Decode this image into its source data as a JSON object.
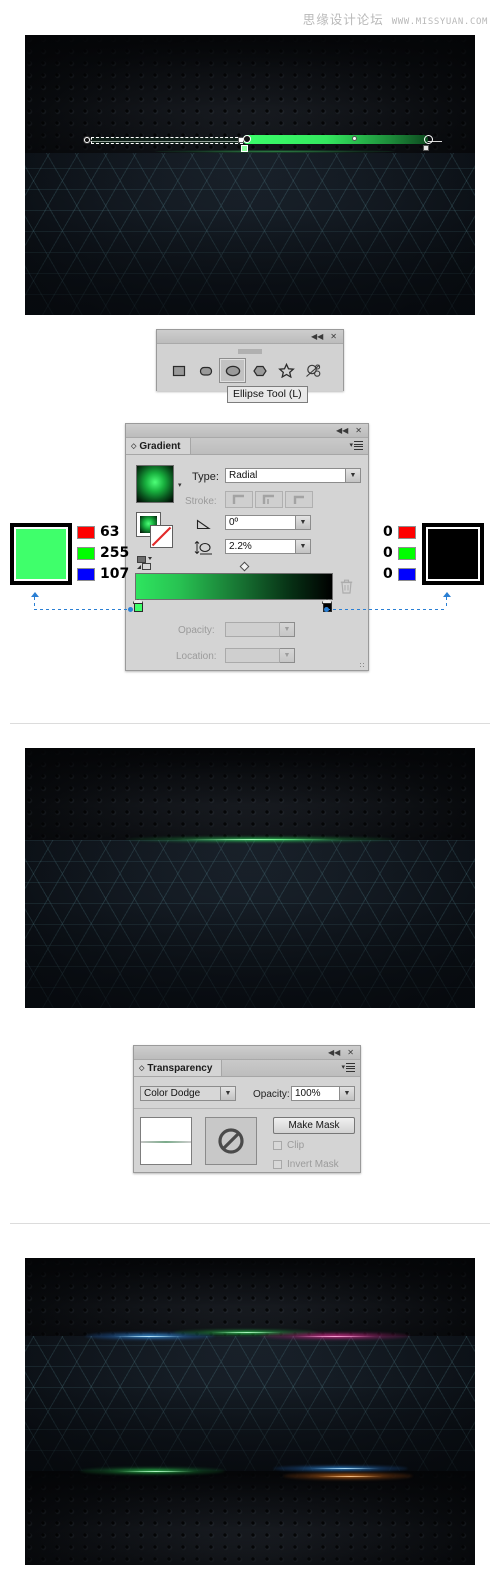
{
  "watermark": {
    "cn": "思缘设计论坛",
    "url": "WWW.MISSYUAN.COM"
  },
  "artworks": [
    {
      "name": "step1-gradient-ellipse-canvas",
      "caption_none": "",
      "annotation": "radial gradient annotator on green ellipse"
    },
    {
      "name": "step2-green-glow-result",
      "annotation": "single green glow streak"
    },
    {
      "name": "step3-final-multicolor-result",
      "annotation": "blue green pink orange glow streaks"
    }
  ],
  "tool_flyout": {
    "title": "shape-tools-flyout",
    "collapse_label": "◀◀",
    "close_label": "✕",
    "tools": [
      {
        "name": "rectangle-tool",
        "label": "Rectangle Tool",
        "selected": false
      },
      {
        "name": "rounded-rectangle-tool",
        "label": "Rounded Rectangle Tool",
        "selected": false
      },
      {
        "name": "ellipse-tool",
        "label": "Ellipse Tool",
        "selected": true
      },
      {
        "name": "polygon-tool",
        "label": "Polygon Tool",
        "selected": false
      },
      {
        "name": "star-tool",
        "label": "Star Tool",
        "selected": false
      },
      {
        "name": "flare-tool",
        "label": "Flare Tool",
        "selected": false
      }
    ],
    "tooltip": "Ellipse Tool (L)"
  },
  "gradient_panel": {
    "tab_label": "Gradient",
    "collapse_label": "◀◀",
    "close_label": "✕",
    "type_label": "Type:",
    "type_value": "Radial",
    "stroke_label": "Stroke:",
    "stroke_options": [
      "stroke-within",
      "stroke-across",
      "stroke-along"
    ],
    "angle_label": "angle",
    "angle_value": "0º",
    "aspect_label": "aspect-ratio",
    "aspect_value": "2.2%",
    "opacity_label": "Opacity:",
    "opacity_value": "",
    "location_label": "Location:",
    "location_value": "",
    "delete_stop_label": "delete-stop",
    "gradient_preview": "radial green to black",
    "stops": [
      {
        "name": "gradient-stop-start",
        "color": "#3FFF6B",
        "position": 0
      },
      {
        "name": "gradient-stop-end",
        "color": "#000000",
        "position": 100
      }
    ],
    "midpoint": 50
  },
  "color_left": {
    "name": "start-color-swatch",
    "swatch": "#3FFF6B",
    "channels": [
      {
        "name": "red",
        "chip": "#FF0000",
        "value": "63"
      },
      {
        "name": "green",
        "chip": "#00FF00",
        "value": "255"
      },
      {
        "name": "blue",
        "chip": "#0000FF",
        "value": "107"
      }
    ]
  },
  "color_right": {
    "name": "end-color-swatch",
    "swatch": "#000000",
    "channels": [
      {
        "name": "red",
        "chip": "#FF0000",
        "value": "0"
      },
      {
        "name": "green",
        "chip": "#00FF00",
        "value": "0"
      },
      {
        "name": "blue",
        "chip": "#0000FF",
        "value": "0"
      }
    ]
  },
  "transparency_panel": {
    "tab_label": "Transparency",
    "collapse_label": "◀◀",
    "close_label": "✕",
    "blend_mode": "Color Dodge",
    "opacity_label": "Opacity:",
    "opacity_value": "100%",
    "make_mask_label": "Make Mask",
    "clip_label": "Clip",
    "invert_mask_label": "Invert Mask",
    "mask_state": "no-mask"
  }
}
